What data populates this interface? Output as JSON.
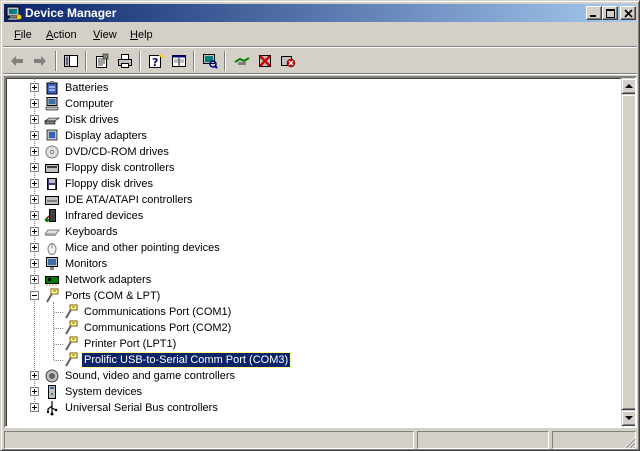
{
  "window": {
    "title": "Device Manager"
  },
  "title_buttons": {
    "minimize": "minimize",
    "maximize": "maximize",
    "close": "close"
  },
  "menu": {
    "file": {
      "accel": "F",
      "rest": "ile"
    },
    "action": {
      "accel": "A",
      "rest": "ction"
    },
    "view": {
      "accel": "V",
      "rest": "iew"
    },
    "help": {
      "accel": "H",
      "rest": "elp"
    }
  },
  "toolbar": {
    "buttons": [
      "back-arrow-icon",
      "forward-arrow-icon",
      "show-hide-console-tree-icon",
      "properties-icon",
      "print-icon",
      "help-icon",
      "export-list-icon",
      "scan-hardware-icon",
      "update-driver-icon",
      "disable-device-icon",
      "uninstall-device-icon"
    ]
  },
  "tree": {
    "categories": [
      "Batteries",
      "Computer",
      "Disk drives",
      "Display adapters",
      "DVD/CD-ROM drives",
      "Floppy disk controllers",
      "Floppy disk drives",
      "IDE ATA/ATAPI controllers",
      "Infrared devices",
      "Keyboards",
      "Mice and other pointing devices",
      "Monitors",
      "Network adapters",
      "Ports (COM & LPT)"
    ],
    "ports_children": [
      "Communications Port (COM1)",
      "Communications Port (COM2)",
      "Printer Port (LPT1)",
      "Prolific USB-to-Serial Comm Port (COM3)"
    ],
    "selected": "Prolific USB-to-Serial Comm Port (COM3)",
    "categories_after": [
      "Sound, video and game controllers",
      "System devices",
      "Universal Serial Bus controllers"
    ]
  },
  "colors": {
    "title_start": "#0a246a",
    "title_end": "#a6caf0",
    "selection": "#0a246a",
    "face": "#d4d0c8"
  }
}
